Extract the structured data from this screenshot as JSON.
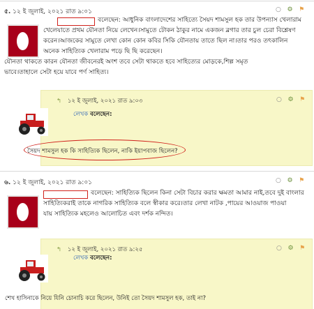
{
  "comments": [
    {
      "number": "৫.",
      "date": "১২ ই জুলাই, ২০২১ রাত ৯:০১",
      "said": "বলেছেন:",
      "line1_rest": "আধুনিক বাংলাদেশের সাহিত্যে সৈয়দ শামসুল হক তার উপন্যাস খেলারাম",
      "line2": "খেলেযাতে প্রথম যৌনতা নিয়ে লেখেন।সামুতে টোকন ঠাকুর নামে একজন ব্লগার তার চুল চেরা বিশ্লেষণ",
      "line3": "করেন।আজকের সামুতে লেখা কোন কোন কবির সিকি যৌনতায় তাতে ছিল না।তার পরও তৎকালিন",
      "line4": "অনেক সাহিত্যিক খেলারাম পড়ে ছি ছি করেছেন।",
      "line5": "যৌনতা থাকতে কারন যৌনতা জীবনেরই অংশ তবে সেটা থাকতে হবে সাহিত্যের মোড়কে,শিল্প সমৃত",
      "line6": "ভাবে।তাহালে সেটা হয়ে যাবে পর্ণ সাহিত্য।",
      "reply": {
        "date": "১২ ই জুলাই, ২০২১ রাত ৯:০৩",
        "author_label": "লেখক",
        "said": "বলেছেন:",
        "text": "সৈয়দ শামসুল হক কি সাহিত্যিক ছিলেন, নাকি ইয়াপবাজ ছিলেন?"
      }
    },
    {
      "number": "৬.",
      "date": "১২ ই জুলাই, ২০২১ রাত ৯:০১",
      "said": "বলেছেন:",
      "line1_rest": "সাহিত্যিক ছিলেন কিনা সেটা বিচার করার ক্ষমতা আমার নাই,তবে দুই বাংলার",
      "line2": "সাহিত্যিকরাই তাকে নাগরিক সাহিত্যিক বলে স্বীকার করে।তার লেখা নাটক ,পায়ের আওয়াজ পাওয়া",
      "line3": "যায় সাহিত্যিক মহলেও আলোচিত এবং দর্শক নন্দিত।",
      "reply": {
        "date": "১২ ই জুলাই, ২০২১ রাত ৯:২৫",
        "author_label": "লেখক",
        "said": "বলেছেন:",
        "text": "শেখ হাসিনাকে নিয়ে যিনি চোনাচি করে ছিলেন, উনিই তো সৈয়দ শামসুল হক, তাই না?"
      }
    }
  ],
  "icons": {
    "circle": "○",
    "gear": "⚙",
    "flag": "⚑",
    "reply_arrow": "↰"
  },
  "colors": {
    "highlight": "#d0201a",
    "reply_bg": "#f8f7c8",
    "avatar_red": "#a8001a",
    "author_link": "#2b61b5"
  }
}
